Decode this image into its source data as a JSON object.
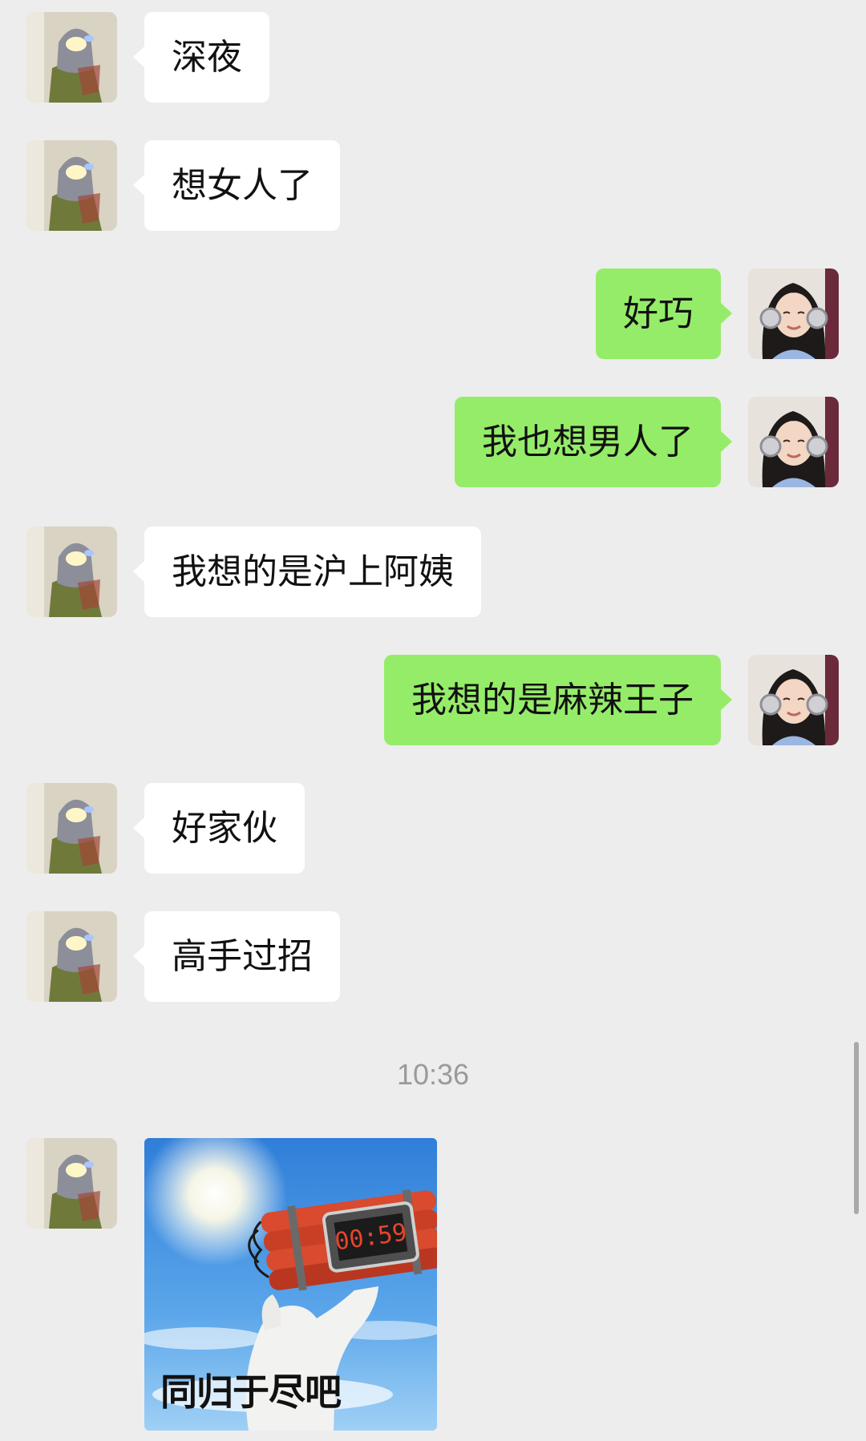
{
  "messages": [
    {
      "side": "left",
      "text": "深夜"
    },
    {
      "side": "left",
      "text": "想女人了"
    },
    {
      "side": "right",
      "text": "好巧"
    },
    {
      "side": "right",
      "text": "我也想男人了"
    },
    {
      "side": "left",
      "text": "我想的是沪上阿姨"
    },
    {
      "side": "right",
      "text": "我想的是麻辣王子"
    },
    {
      "side": "left",
      "text": "好家伙"
    },
    {
      "side": "left",
      "text": "高手过招"
    }
  ],
  "timestamp": "10:36",
  "sticker": {
    "caption": "同归于尽吧",
    "timer_display": "00:59"
  },
  "colors": {
    "background": "#ededed",
    "incoming_bubble": "#ffffff",
    "outgoing_bubble": "#95ec69"
  }
}
